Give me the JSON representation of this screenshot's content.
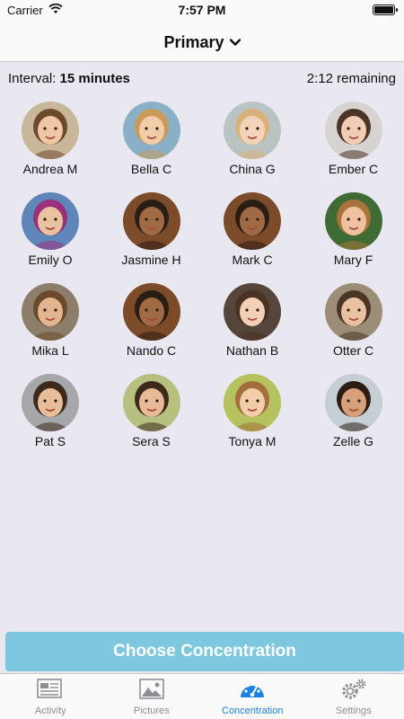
{
  "status_bar": {
    "carrier": "Carrier",
    "time": "7:57 PM"
  },
  "nav": {
    "title": "Primary"
  },
  "info": {
    "interval_label": "Interval:",
    "interval_value": "15 minutes",
    "remaining": "2:12 remaining"
  },
  "students": [
    {
      "name": "Andrea M",
      "bg": "#c9b79b",
      "skin": "#f0c7a5",
      "hair": "#6b4a2c"
    },
    {
      "name": "Bella C",
      "bg": "#8ab0c8",
      "skin": "#f2cba8",
      "hair": "#c99a5a"
    },
    {
      "name": "China G",
      "bg": "#b9c3c2",
      "skin": "#f3d4bb",
      "hair": "#d8b27a"
    },
    {
      "name": "Ember C",
      "bg": "#d7d3d1",
      "skin": "#f0cdb4",
      "hair": "#4a3526"
    },
    {
      "name": "Emily O",
      "bg": "#5f86b8",
      "skin": "#e9c3a1",
      "hair": "#9a2f7a"
    },
    {
      "name": "Jasmine H",
      "bg": "#7c4b2a",
      "skin": "#a06b44",
      "hair": "#2a1e14"
    },
    {
      "name": "Mark C",
      "bg": "#7c4b2a",
      "skin": "#a06b44",
      "hair": "#2a1e14"
    },
    {
      "name": "Mary F",
      "bg": "#3f6b35",
      "skin": "#eec19f",
      "hair": "#a9733d"
    },
    {
      "name": "Mika L",
      "bg": "#8d7e6c",
      "skin": "#e2b48f",
      "hair": "#6b4a2c"
    },
    {
      "name": "Nando C",
      "bg": "#7c4b2a",
      "skin": "#a06b44",
      "hair": "#2a1e14"
    },
    {
      "name": "Nathan B",
      "bg": "#56453a",
      "skin": "#f3d0b5",
      "hair": "#4a3122"
    },
    {
      "name": "Otter C",
      "bg": "#9b8d76",
      "skin": "#e8c2a0",
      "hair": "#4a3526"
    },
    {
      "name": "Pat S",
      "bg": "#a5a7a8",
      "skin": "#e8bd9a",
      "hair": "#3d2a1d"
    },
    {
      "name": "Sera S",
      "bg": "#b7c07e",
      "skin": "#e7b996",
      "hair": "#3d2a1d"
    },
    {
      "name": "Tonya M",
      "bg": "#b5c25e",
      "skin": "#f1cda9",
      "hair": "#a46e3a"
    },
    {
      "name": "Zelle G",
      "bg": "#c4ced3",
      "skin": "#d7a07a",
      "hair": "#2b1c14"
    }
  ],
  "choose_button": {
    "label": "Choose Concentration"
  },
  "tabs": [
    {
      "label": "Activity",
      "icon": "newspaper-icon"
    },
    {
      "label": "Pictures",
      "icon": "picture-icon"
    },
    {
      "label": "Concentration",
      "icon": "gauge-icon"
    },
    {
      "label": "Settings",
      "icon": "gears-icon"
    }
  ],
  "colors": {
    "accent": "#1a82e2",
    "button": "#7ec8df",
    "background": "#e9e8f0"
  }
}
